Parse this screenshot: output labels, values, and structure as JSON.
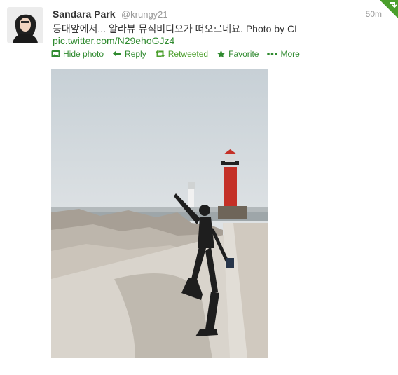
{
  "tweet": {
    "fullname": "Sandara Park",
    "username": "@krungy21",
    "time": "50m",
    "text": "등대앞에서... 알라뷰 뮤직비디오가 떠오르네요. Photo by CL",
    "link": "pic.twitter.com/N29ehoGJz4"
  },
  "actions": {
    "hide_photo": "Hide photo",
    "reply": "Reply",
    "retweeted": "Retweeted",
    "favorite": "Favorite",
    "more": "More"
  },
  "icons": {
    "corner": "retweet-corner-icon",
    "hide_photo": "photo-icon",
    "reply": "reply-arrow-icon",
    "retweeted": "retweet-icon",
    "favorite": "star-icon",
    "more": "ellipsis-icon"
  },
  "colors": {
    "link": "#2f8a2f",
    "retweeted": "#4b9f2c",
    "muted": "#999999"
  }
}
